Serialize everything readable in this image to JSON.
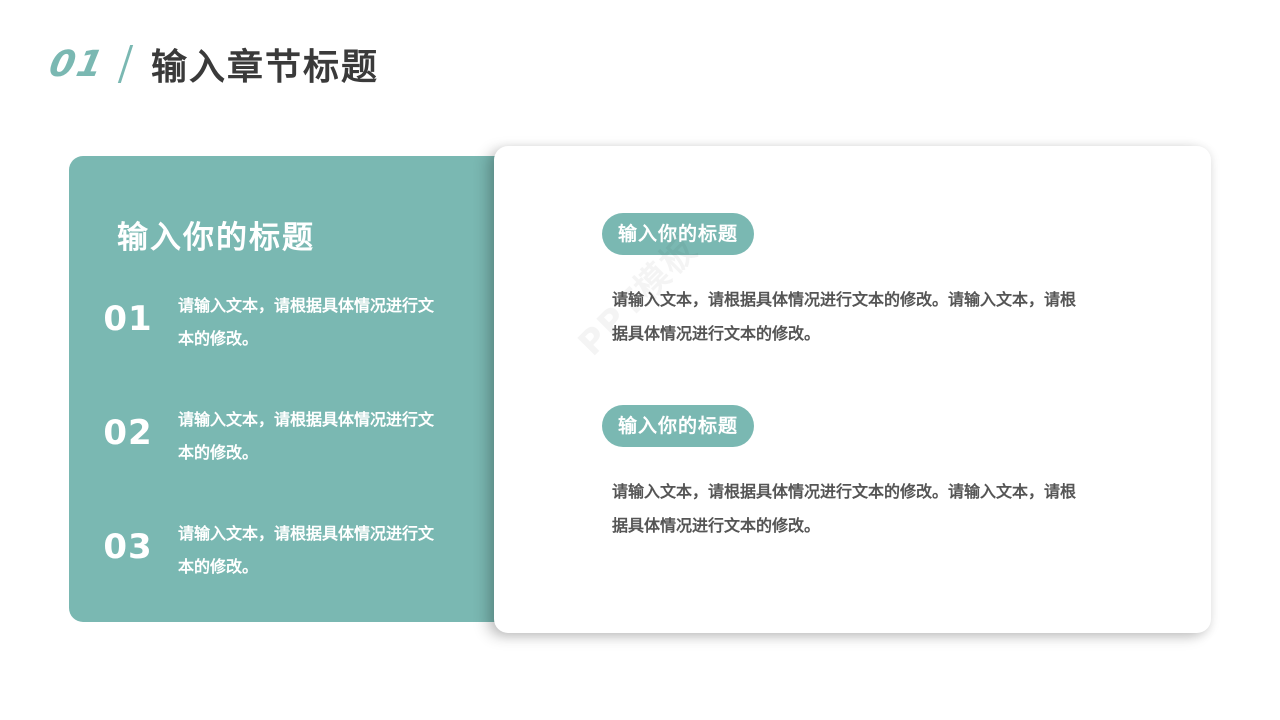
{
  "header": {
    "chapter_number": "01",
    "chapter_title": "输入章节标题"
  },
  "left_panel": {
    "title": "输入你的标题",
    "points": [
      {
        "number": "01",
        "text": "请输入文本，请根据具体情况进行文本的修改。"
      },
      {
        "number": "02",
        "text": "请输入文本，请根据具体情况进行文本的修改。"
      },
      {
        "number": "03",
        "text": "请输入文本，请根据具体情况进行文本的修改。"
      }
    ]
  },
  "right_card": {
    "sections": [
      {
        "heading": "输入你的标题",
        "body": "请输入文本，请根据具体情况进行文本的修改。请输入文本，请根据具体情况进行文本的修改。"
      },
      {
        "heading": "输入你的标题",
        "body": "请输入文本，请根据具体情况进行文本的修改。请输入文本，请根据具体情况进行文本的修改。"
      }
    ]
  },
  "watermark": {
    "text": "PPT模板"
  },
  "colors": {
    "accent": "#7ab8b2",
    "title_text": "#3a3a3a",
    "body_text": "#555555"
  }
}
